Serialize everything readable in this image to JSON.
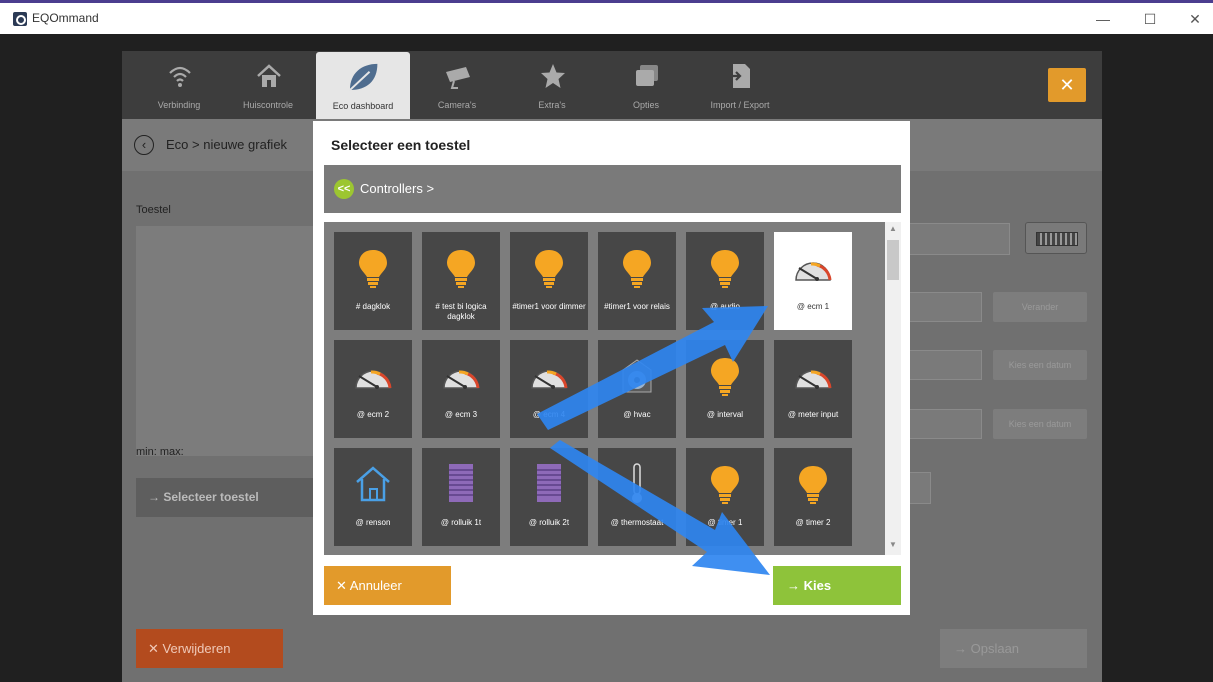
{
  "window": {
    "title": "EQOmmand",
    "minimize": "—",
    "maximize": "☐",
    "close": "✕"
  },
  "nav": [
    {
      "label": "Verbinding",
      "icon": "wifi-icon"
    },
    {
      "label": "Huiscontrole",
      "icon": "home-icon"
    },
    {
      "label": "Eco dashboard",
      "icon": "leaf-icon",
      "active": true
    },
    {
      "label": "Camera's",
      "icon": "camera-icon"
    },
    {
      "label": "Extra's",
      "icon": "star-icon"
    },
    {
      "label": "Opties",
      "icon": "windows-icon"
    },
    {
      "label": "Import / Export",
      "icon": "import-export-icon"
    }
  ],
  "nav_close": "✕",
  "breadcrumb": {
    "back": "‹",
    "text": "Eco  >  nieuwe grafiek"
  },
  "form": {
    "toestel_label": "Toestel",
    "minmax": "min:  max:",
    "select_button": "→   Selecteer toestel",
    "change_button": "Verander",
    "date_button_1": "Kies een datum",
    "date_button_2": "Kies een datum",
    "delete_button": "✕  Verwijderen",
    "save_button": "→   Opslaan"
  },
  "modal": {
    "title": "Selecteer een toestel",
    "path_back": "<<",
    "path_text": "Controllers  >",
    "cancel_button": "✕  Annuleer",
    "choose_button": "→   Kies",
    "tiles": [
      {
        "label": "# dagklok",
        "icon": "bulb"
      },
      {
        "label": "# test bi logica dagklok",
        "icon": "bulb"
      },
      {
        "label": "#timer1 voor dimmer",
        "icon": "bulb"
      },
      {
        "label": "#timer1 voor relais",
        "icon": "bulb"
      },
      {
        "label": "@ audio",
        "icon": "bulb"
      },
      {
        "label": "@ ecm 1",
        "icon": "gauge",
        "selected": true
      },
      {
        "label": "@ ecm 2",
        "icon": "gauge"
      },
      {
        "label": "@ ecm 3",
        "icon": "gauge"
      },
      {
        "label": "@ ecm 4",
        "icon": "gauge"
      },
      {
        "label": "@ hvac",
        "icon": "fan"
      },
      {
        "label": "@ interval",
        "icon": "bulb"
      },
      {
        "label": "@ meter input",
        "icon": "gauge"
      },
      {
        "label": "@ renson",
        "icon": "house"
      },
      {
        "label": "@ rolluik 1t",
        "icon": "shutter"
      },
      {
        "label": "@ rolluik 2t",
        "icon": "shutter"
      },
      {
        "label": "@ thermostaat",
        "icon": "thermometer"
      },
      {
        "label": "@ timer 1",
        "icon": "bulb"
      },
      {
        "label": "@ timer 2",
        "icon": "bulb"
      }
    ]
  },
  "colors": {
    "orange": "#e29a2b",
    "green": "#8ec33a",
    "red": "#b34b1e",
    "arrow": "#2f86f0"
  }
}
